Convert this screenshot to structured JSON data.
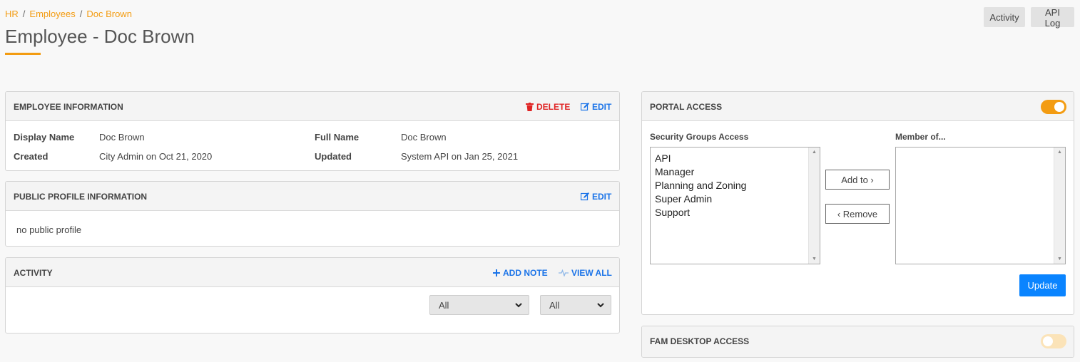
{
  "breadcrumb": {
    "items": [
      "HR",
      "Employees",
      "Doc Brown"
    ],
    "separator": "/"
  },
  "page_title": "Employee - Doc Brown",
  "top_buttons": {
    "activity": "Activity",
    "api_log": "API Log"
  },
  "employee_info": {
    "title": "EMPLOYEE INFORMATION",
    "delete_label": "DELETE",
    "edit_label": "EDIT",
    "fields": {
      "display_name_label": "Display Name",
      "display_name_value": "Doc Brown",
      "full_name_label": "Full Name",
      "full_name_value": "Doc Brown",
      "created_label": "Created",
      "created_value": "City Admin on Oct 21, 2020",
      "updated_label": "Updated",
      "updated_value": "System API on Jan 25, 2021"
    }
  },
  "public_profile": {
    "title": "PUBLIC PROFILE INFORMATION",
    "edit_label": "EDIT",
    "body": "no public profile"
  },
  "activity": {
    "title": "ACTIVITY",
    "add_note_label": "ADD NOTE",
    "view_all_label": "VIEW ALL",
    "filter1": "All",
    "filter2": "All"
  },
  "portal_access": {
    "title": "PORTAL ACCESS",
    "enabled": true,
    "security_groups_label": "Security Groups Access",
    "member_of_label": "Member of...",
    "groups": [
      "API",
      "Manager",
      "Planning and Zoning",
      "Super Admin",
      "Support"
    ],
    "add_to_label": "Add to ›",
    "remove_label": "‹ Remove",
    "update_label": "Update"
  },
  "fam_desktop": {
    "title": "FAM DESKTOP ACCESS",
    "enabled": false
  },
  "colors": {
    "accent": "#f39c12",
    "link": "#1a73e8",
    "danger": "#e02424",
    "primary_button": "#0a84ff"
  }
}
